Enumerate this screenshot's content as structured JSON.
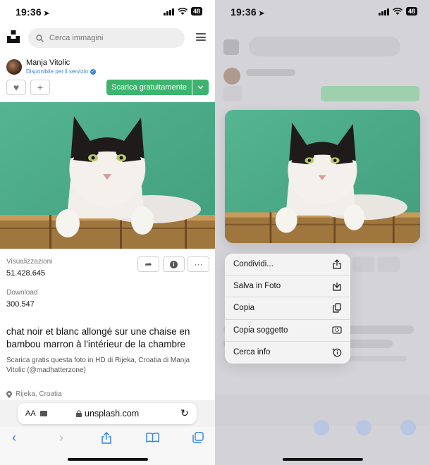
{
  "status": {
    "time": "19:36",
    "battery": "48"
  },
  "header": {
    "search_placeholder": "Cerca immagini"
  },
  "author": {
    "name": "Manja Vitolic",
    "availability": "Disponibile per il servizio"
  },
  "buttons": {
    "download": "Scarica gratuitamente"
  },
  "stats": {
    "views_label": "Visualizzazioni",
    "views_value": "51.428.645",
    "downloads_label": "Download",
    "downloads_value": "300.547"
  },
  "photo": {
    "title": "chat noir et blanc allongé sur une chaise en bambou marron à l'intérieur de la chambre",
    "description": "Scarica gratis questa foto in HD di Rijeka, Croatia di Manja Vitolic (@madhatterzone)",
    "location": "Rijeka, Croatia"
  },
  "browser": {
    "text_size": "AA",
    "url": "unsplash.com"
  },
  "context_menu": {
    "items": [
      {
        "label": "Condividi...",
        "icon": "share-icon"
      },
      {
        "label": "Salva in Foto",
        "icon": "save-icon"
      },
      {
        "label": "Copia",
        "icon": "copy-icon"
      },
      {
        "label": "Copia soggetto",
        "icon": "copy-subject-icon"
      },
      {
        "label": "Cerca info",
        "icon": "look-up-icon"
      }
    ]
  },
  "colors": {
    "accent_green": "#3cb46e",
    "link_blue": "#3d83d8",
    "ios_blue": "#2f80ed"
  }
}
